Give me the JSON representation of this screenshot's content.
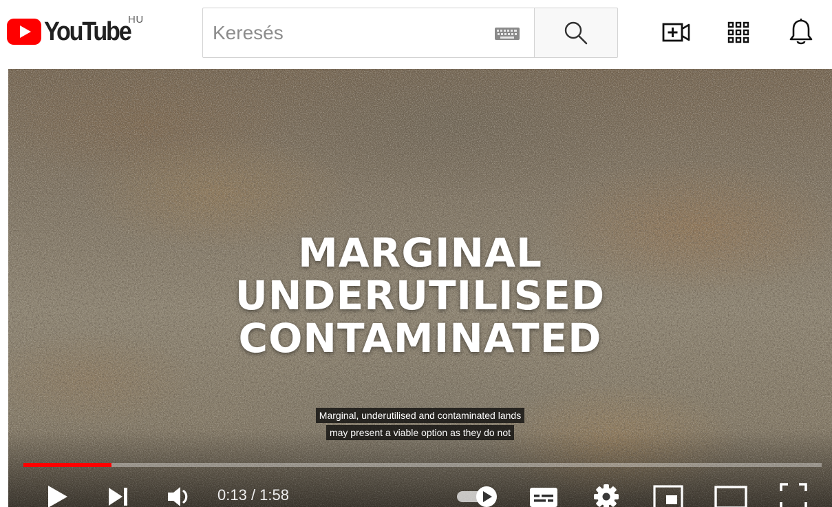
{
  "header": {
    "logo_text": "YouTube",
    "country_code": "HU",
    "search_placeholder": "Keresés",
    "icons": [
      "youtube-logo",
      "keyboard-icon",
      "search-icon",
      "create-video-icon",
      "apps-grid-icon",
      "notifications-bell-icon"
    ]
  },
  "video": {
    "overlay_title": [
      "MARGINAL",
      "UNDERUTILISED",
      "CONTAMINATED"
    ],
    "subtitles": [
      "Marginal, underutilised and contaminated lands",
      "may present a viable option as they do not"
    ],
    "progress_fraction": 0.11
  },
  "controls": {
    "current_time": "0:13",
    "duration": "1:58",
    "time_display": "0:13 / 1:58",
    "icons": [
      "play-icon",
      "next-icon",
      "volume-icon",
      "autoplay-toggle",
      "subtitles-icon",
      "settings-icon",
      "miniplayer-icon",
      "theater-mode-icon",
      "fullscreen-icon"
    ]
  },
  "colors": {
    "brand_red": "#ff0000",
    "progress_red": "#ff0000",
    "text_dark": "#212121"
  }
}
